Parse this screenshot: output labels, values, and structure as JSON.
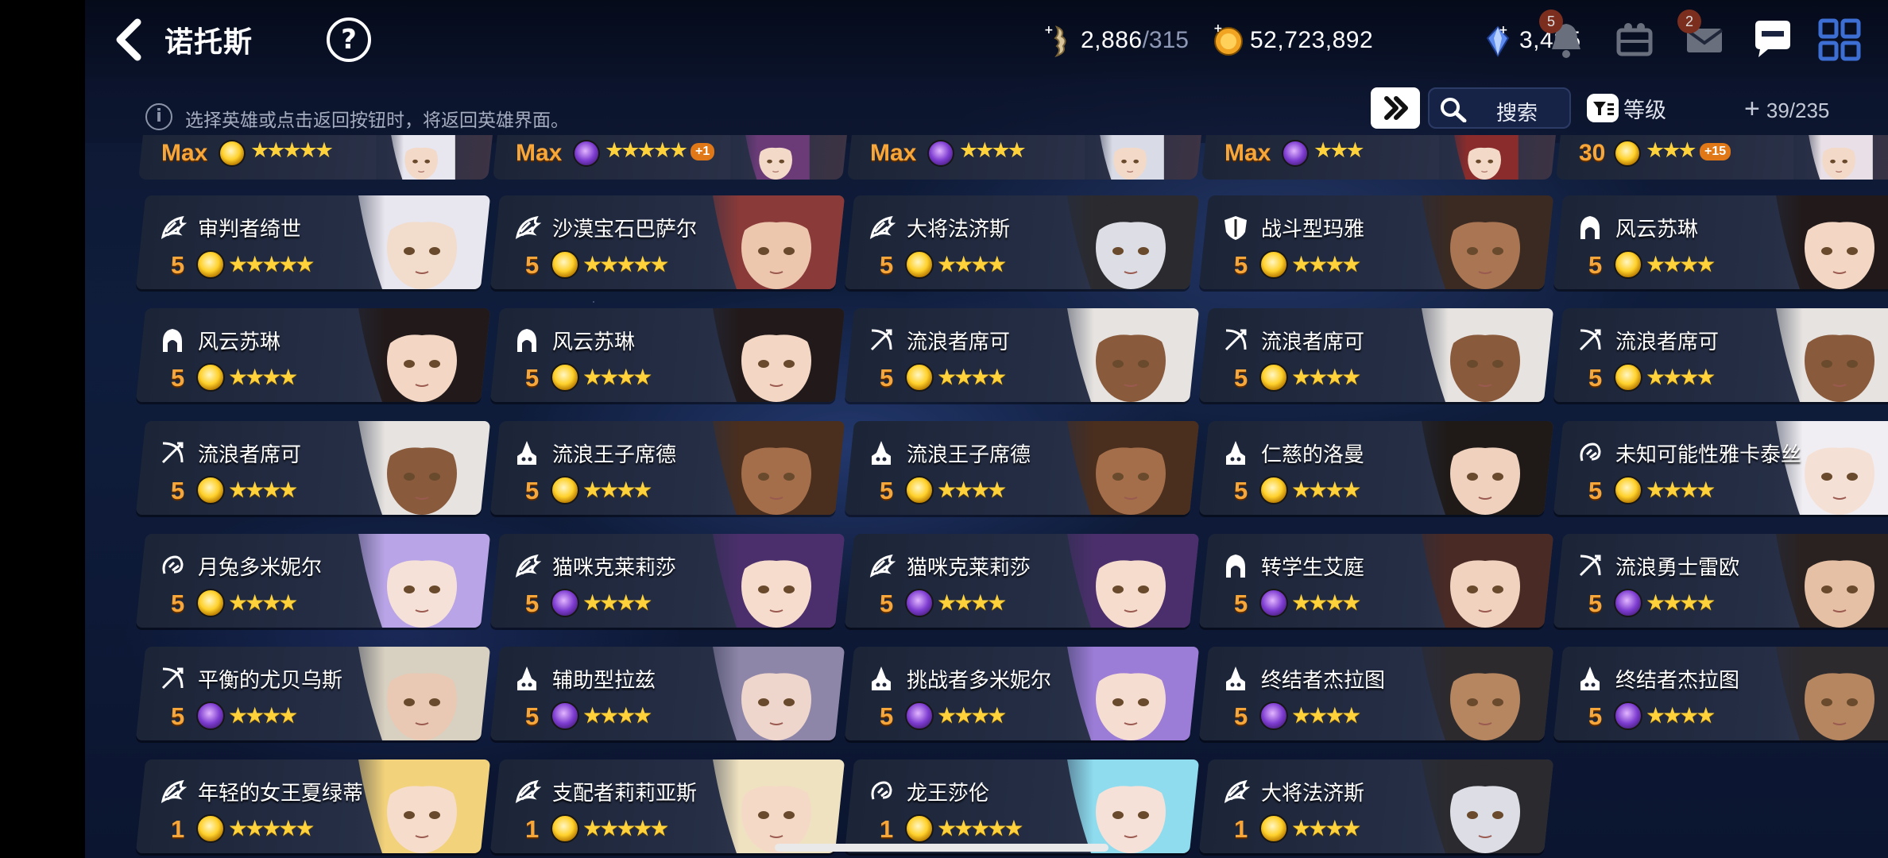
{
  "header": {
    "title": "诺托斯",
    "help_label": "?"
  },
  "resources": {
    "stamina": {
      "value": "2,886",
      "max": "/315"
    },
    "gold": {
      "value": "52,723,892"
    },
    "crystal": {
      "value": "3,425"
    }
  },
  "top_icons": {
    "notifications_badge": "5",
    "mail_badge": "2"
  },
  "info_text": "选择英雄或点击返回按钮时，将返回英雄界面。",
  "toolbar": {
    "search_label": "搜索",
    "sort_label": "等级",
    "count": "39/235"
  },
  "partial_row": [
    {
      "level": "Max",
      "element": "light",
      "stars": "★★★★★",
      "badge": ""
    },
    {
      "level": "Max",
      "element": "dark",
      "stars": "★★★★★",
      "badge": "+1"
    },
    {
      "level": "Max",
      "element": "dark",
      "stars": "★★★★",
      "badge": ""
    },
    {
      "level": "Max",
      "element": "dark",
      "stars": "★★★",
      "badge": ""
    },
    {
      "level": "30",
      "element": "light",
      "stars": "★★★",
      "badge": "+15"
    }
  ],
  "heroes": [
    {
      "name": "审判者绮世",
      "role": "wing",
      "level": "5",
      "element": "light",
      "stars": "★★★★★",
      "hair": "#e8e6ee",
      "skin": "#f2dccb"
    },
    {
      "name": "沙漠宝石巴萨尔",
      "role": "wing",
      "level": "5",
      "element": "light",
      "stars": "★★★★★",
      "hair": "#8a3a38",
      "skin": "#edc6ae"
    },
    {
      "name": "大将法济斯",
      "role": "wing",
      "level": "5",
      "element": "light",
      "stars": "★★★★",
      "hair": "#2b2b2f",
      "skin": "#dcdde5"
    },
    {
      "name": "战斗型玛雅",
      "role": "shield",
      "level": "5",
      "element": "light",
      "stars": "★★★★",
      "hair": "#3a2a22",
      "skin": "#a97552"
    },
    {
      "name": "风云苏琳",
      "role": "hood",
      "level": "5",
      "element": "light",
      "stars": "★★★★",
      "hair": "#221a1a",
      "skin": "#f3d6c4"
    },
    {
      "name": "风云苏琳",
      "role": "hood",
      "level": "5",
      "element": "light",
      "stars": "★★★★",
      "hair": "#221a1a",
      "skin": "#f3d6c4"
    },
    {
      "name": "风云苏琳",
      "role": "hood",
      "level": "5",
      "element": "light",
      "stars": "★★★★",
      "hair": "#221a1a",
      "skin": "#f3d6c4"
    },
    {
      "name": "流浪者席可",
      "role": "bow",
      "level": "5",
      "element": "light",
      "stars": "★★★★",
      "hair": "#e6e3e0",
      "skin": "#8a5a3c"
    },
    {
      "name": "流浪者席可",
      "role": "bow",
      "level": "5",
      "element": "light",
      "stars": "★★★★",
      "hair": "#e6e3e0",
      "skin": "#8a5a3c"
    },
    {
      "name": "流浪者席可",
      "role": "bow",
      "level": "5",
      "element": "light",
      "stars": "★★★★",
      "hair": "#e6e3e0",
      "skin": "#8a5a3c"
    },
    {
      "name": "流浪者席可",
      "role": "bow",
      "level": "5",
      "element": "light",
      "stars": "★★★★",
      "hair": "#e6e3e0",
      "skin": "#8a5a3c"
    },
    {
      "name": "流浪王子席德",
      "role": "mage",
      "level": "5",
      "element": "light",
      "stars": "★★★★",
      "hair": "#4a2e1e",
      "skin": "#a46e4a"
    },
    {
      "name": "流浪王子席德",
      "role": "mage",
      "level": "5",
      "element": "light",
      "stars": "★★★★",
      "hair": "#4a2e1e",
      "skin": "#a46e4a"
    },
    {
      "name": "仁慈的洛曼",
      "role": "mage",
      "level": "5",
      "element": "light",
      "stars": "★★★★",
      "hair": "#1f1a18",
      "skin": "#efd1bd"
    },
    {
      "name": "未知可能性雅卡泰丝",
      "role": "support",
      "level": "5",
      "element": "light",
      "stars": "★★★★",
      "hair": "#f0eef2",
      "skin": "#f5e0d6"
    },
    {
      "name": "月兔多米妮尔",
      "role": "support",
      "level": "5",
      "element": "light",
      "stars": "★★★★",
      "hair": "#b8a4e6",
      "skin": "#f6e1d8"
    },
    {
      "name": "猫咪克莱莉莎",
      "role": "wing",
      "level": "5",
      "element": "dark",
      "stars": "★★★★",
      "hair": "#4b2f6c",
      "skin": "#f6dccd"
    },
    {
      "name": "猫咪克莱莉莎",
      "role": "wing",
      "level": "5",
      "element": "dark",
      "stars": "★★★★",
      "hair": "#4b2f6c",
      "skin": "#f6dccd"
    },
    {
      "name": "转学生艾庭",
      "role": "hood",
      "level": "5",
      "element": "dark",
      "stars": "★★★★",
      "hair": "#4a2a24",
      "skin": "#f0d2bf"
    },
    {
      "name": "流浪勇士雷欧",
      "role": "bow",
      "level": "5",
      "element": "dark",
      "stars": "★★★★",
      "hair": "#2a2220",
      "skin": "#e6c0a4"
    },
    {
      "name": "平衡的尤贝乌斯",
      "role": "bow",
      "level": "5",
      "element": "dark",
      "stars": "★★★★",
      "hair": "#d8d0c0",
      "skin": "#e9c9b4"
    },
    {
      "name": "辅助型拉兹",
      "role": "mage",
      "level": "5",
      "element": "dark",
      "stars": "★★★★",
      "hair": "#8e86a8",
      "skin": "#efd6cc"
    },
    {
      "name": "挑战者多米妮尔",
      "role": "mage",
      "level": "5",
      "element": "dark",
      "stars": "★★★★",
      "hair": "#9b7cd6",
      "skin": "#f6ddd2"
    },
    {
      "name": "终结者杰拉图",
      "role": "mage",
      "level": "5",
      "element": "dark",
      "stars": "★★★★",
      "hair": "#2d2a2e",
      "skin": "#b58660"
    },
    {
      "name": "终结者杰拉图",
      "role": "mage",
      "level": "5",
      "element": "dark",
      "stars": "★★★★",
      "hair": "#2d2a2e",
      "skin": "#b58660"
    },
    {
      "name": "年轻的女王夏绿蒂",
      "role": "wing",
      "level": "1",
      "element": "light",
      "stars": "★★★★★",
      "hair": "#f2d27a",
      "skin": "#f6dccb"
    },
    {
      "name": "支配者莉莉亚斯",
      "role": "wing",
      "level": "1",
      "element": "light",
      "stars": "★★★★★",
      "hair": "#efe2c0",
      "skin": "#f4d9c7"
    },
    {
      "name": "龙王莎伦",
      "role": "support",
      "level": "1",
      "element": "light",
      "stars": "★★★★★",
      "hair": "#8fdcef",
      "skin": "#f6e1d8"
    },
    {
      "name": "大将法济斯",
      "role": "wing",
      "level": "1",
      "element": "light",
      "stars": "★★★★",
      "hair": "#2b2b2f",
      "skin": "#dcdde5"
    }
  ]
}
